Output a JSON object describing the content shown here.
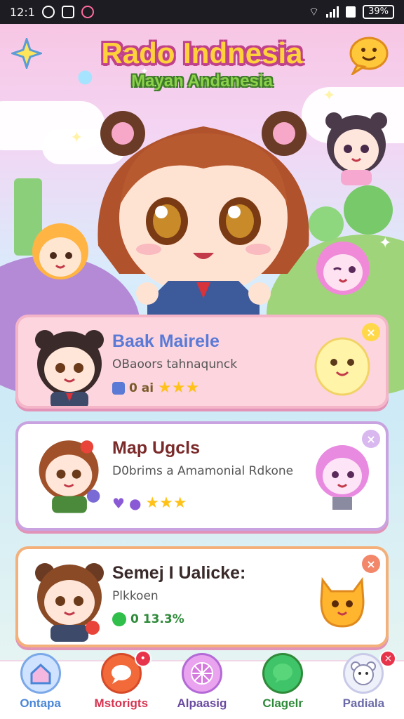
{
  "status_bar": {
    "time": "12:1",
    "battery": "39%"
  },
  "header": {
    "title": "Rado Indnesia",
    "subtitle": "Mayan Andanesia"
  },
  "cards": [
    {
      "title": "Baak Mairele",
      "subtitle": "OBaoors tahnaqunck",
      "meta": "0 ai"
    },
    {
      "title": "Map Ugcls",
      "subtitle": "D0brims a Amamonial Rdkone",
      "meta": ""
    },
    {
      "title": "Semej I Ualicke:",
      "subtitle": "Plkkoen",
      "meta": "0 13.3%"
    }
  ],
  "bottom_nav": [
    {
      "label": "Ontapa",
      "color": "#4a86d8"
    },
    {
      "label": "Mstorigts",
      "color": "#d6334f"
    },
    {
      "label": "Alpaasig",
      "color": "#6a4aa0"
    },
    {
      "label": "Clagelr",
      "color": "#2f8a3a"
    },
    {
      "label": "Padiala",
      "color": "#6a6aa8"
    }
  ],
  "colors": {
    "accent_pink": "#f3a3c6",
    "title_yellow": "#ffd23c",
    "subtitle_green": "#8bd14a",
    "star_gold": "#ffc21a"
  },
  "icons": {
    "home": "home-icon",
    "messages": "chat-icon",
    "explore": "ball-icon",
    "chat": "bubble-icon",
    "profile": "bear-icon"
  }
}
